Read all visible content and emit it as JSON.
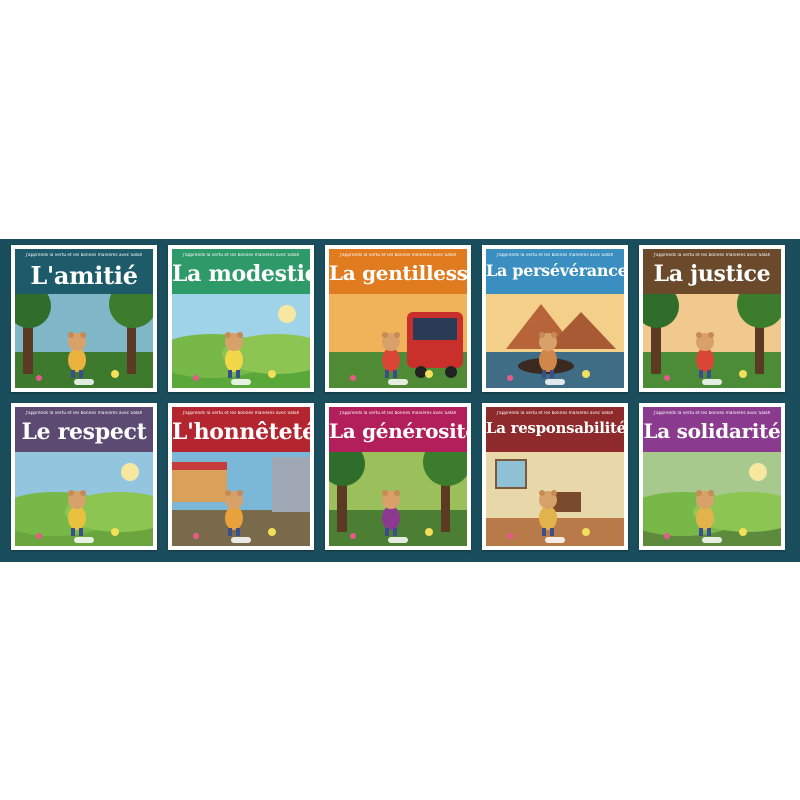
{
  "series_subtitle": "J'apprends la vertu et les bonnes manières avec Sâlah",
  "books": [
    {
      "title": "L'amitié",
      "band_color": "#1d5b6b",
      "accent": "#e8b23c",
      "sky": "#7fb7c9",
      "ground": "#3d7a2e",
      "scene": "forest"
    },
    {
      "title": "La modestie",
      "band_color": "#2e9a6a",
      "accent": "#f2d74a",
      "sky": "#9fd3e8",
      "ground": "#5aa83a",
      "scene": "meadow"
    },
    {
      "title": "La gentillesse",
      "band_color": "#e07b1f",
      "accent": "#d94636",
      "sky": "#f0b35a",
      "ground": "#4f8a35",
      "scene": "bus"
    },
    {
      "title": "La persévérance",
      "band_color": "#3a8fc0",
      "accent": "#d0874c",
      "sky": "#f4cf8a",
      "ground": "#3f6d86",
      "scene": "river"
    },
    {
      "title": "La justice",
      "band_color": "#6b4a2c",
      "accent": "#d94636",
      "sky": "#f1c98e",
      "ground": "#4d8c37",
      "scene": "forest"
    },
    {
      "title": "Le respect",
      "band_color": "#5c4a72",
      "accent": "#e9c13e",
      "sky": "#93c6de",
      "ground": "#6aa63d",
      "scene": "meadow"
    },
    {
      "title": "L'honnêteté",
      "band_color": "#b32630",
      "accent": "#e9a23b",
      "sky": "#7bb8d8",
      "ground": "#7a6a4c",
      "scene": "street"
    },
    {
      "title": "La générosité",
      "band_color": "#b21f5a",
      "accent": "#8c3a8f",
      "sky": "#9bbf5a",
      "ground": "#4c7e34",
      "scene": "forest"
    },
    {
      "title": "La responsabilité",
      "band_color": "#8e2a2c",
      "accent": "#e2b34a",
      "sky": "#f1e3b8",
      "ground": "#b97a4a",
      "scene": "room"
    },
    {
      "title": "La solidarité",
      "band_color": "#8b3b8e",
      "accent": "#e2b34a",
      "sky": "#a8c98e",
      "ground": "#5e8a3e",
      "scene": "meadow"
    }
  ]
}
